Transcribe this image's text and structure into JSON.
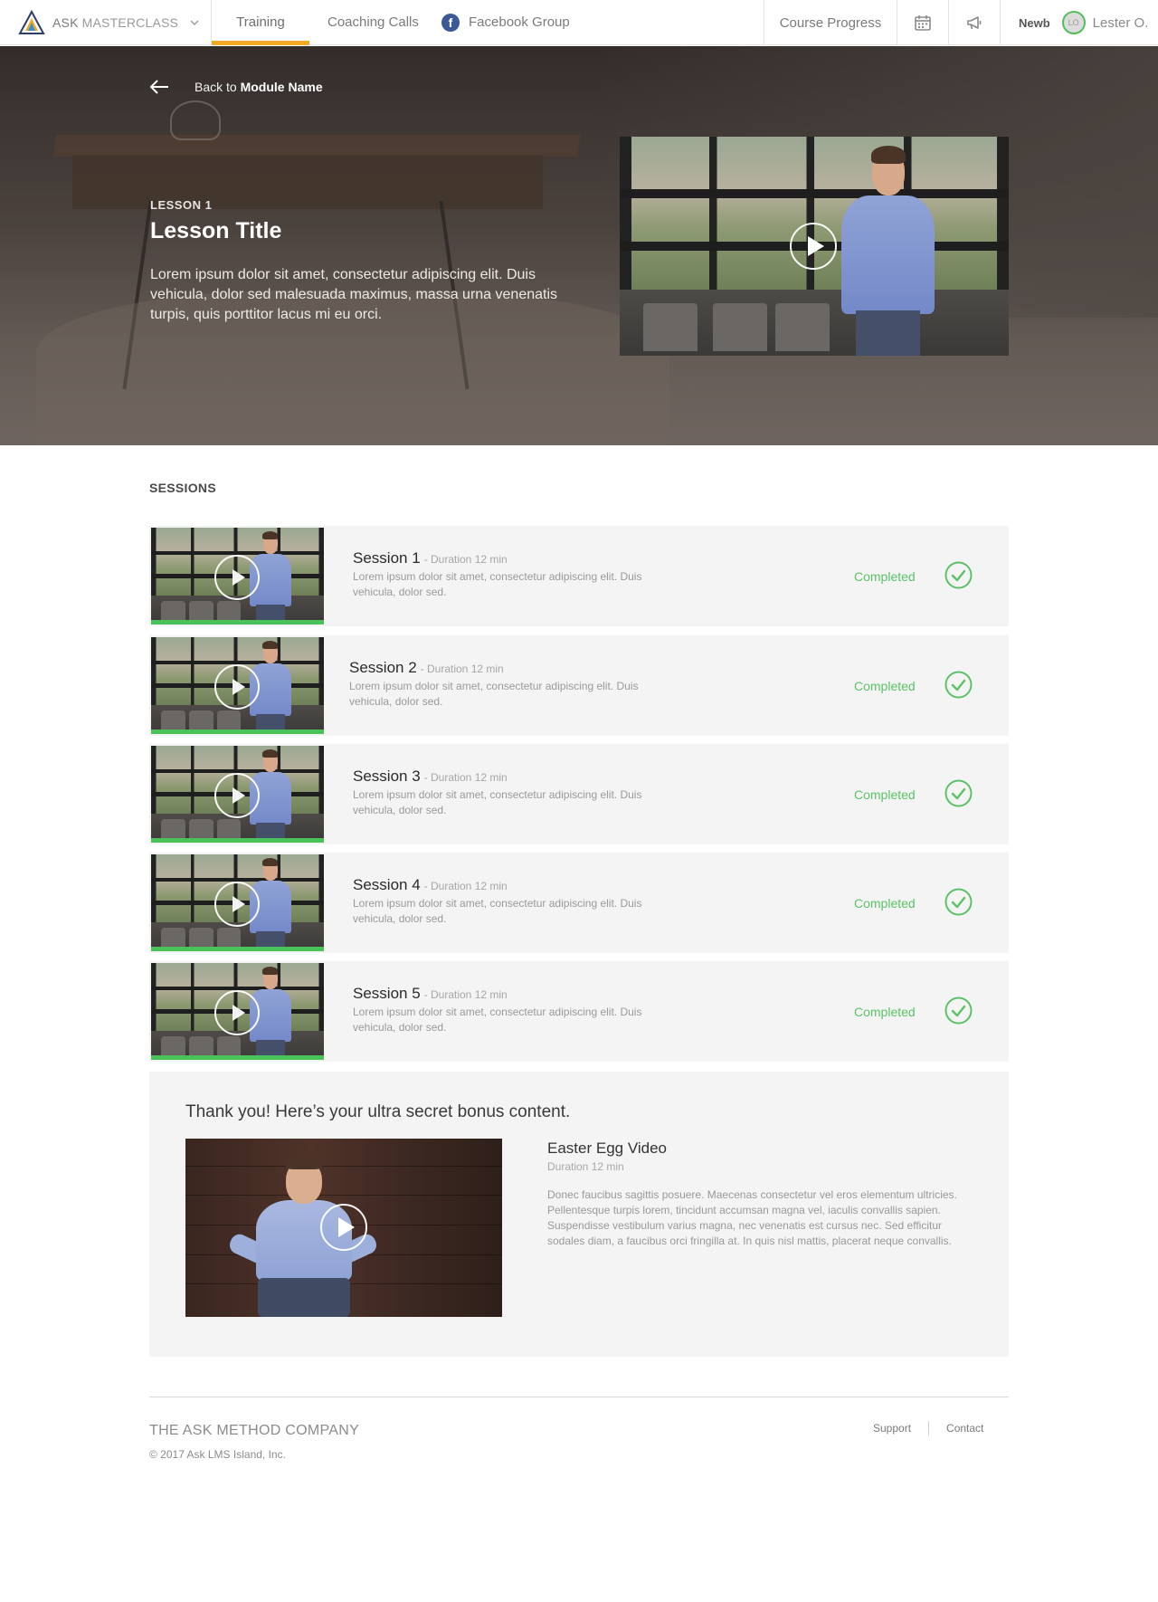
{
  "nav": {
    "brand_primary": "ASK",
    "brand_secondary": "MASTERCLASS",
    "links": {
      "training": "Training",
      "coaching": "Coaching Calls",
      "facebook": "Facebook Group"
    },
    "course_progress": "Course Progress",
    "user_level": "Newb",
    "avatar_initials": "LO",
    "user_name": "Lester O.",
    "active_tab": "Training",
    "accent_color": "#f3a928"
  },
  "hero": {
    "back_prefix": "Back to",
    "back_target": "Module Name",
    "lesson_label": "LESSON 1",
    "lesson_title": "Lesson Title",
    "lesson_description": "Lorem ipsum dolor sit amet, consectetur adipiscing elit. Duis vehicula, dolor sed malesuada maximus, massa urna venenatis turpis, quis porttitor lacus mi eu orci."
  },
  "sessions": {
    "heading": "SESSIONS",
    "status_color": "#5cc167",
    "items": [
      {
        "title": "Session 1",
        "duration": "- Duration 12 min",
        "description": "Lorem ipsum dolor sit amet, consectetur adipiscing elit. Duis vehicula, dolor sed.",
        "status": "Completed",
        "progress": 1.0
      },
      {
        "title": "Session 2",
        "duration": "- Duration 12 min",
        "description": "Lorem ipsum dolor sit amet, consectetur adipiscing elit. Duis vehicula, dolor sed.",
        "status": "Completed",
        "progress": 1.0
      },
      {
        "title": "Session 3",
        "duration": "- Duration 12 min",
        "description": "Lorem ipsum dolor sit amet, consectetur adipiscing elit. Duis vehicula, dolor sed.",
        "status": "Completed",
        "progress": 1.0
      },
      {
        "title": "Session 4",
        "duration": "- Duration 12 min",
        "description": "Lorem ipsum dolor sit amet, consectetur adipiscing elit. Duis vehicula, dolor sed.",
        "status": "Completed",
        "progress": 1.0
      },
      {
        "title": "Session 5",
        "duration": "- Duration 12 min",
        "description": "Lorem ipsum dolor sit amet, consectetur adipiscing elit. Duis vehicula, dolor sed.",
        "status": "Completed",
        "progress": 1.0
      }
    ]
  },
  "bonus": {
    "heading": "Thank you! Here’s your ultra secret bonus content.",
    "video_title": "Easter Egg Video",
    "duration": "Duration 12 min",
    "description": "Donec faucibus sagittis posuere. Maecenas consectetur vel eros elementum ultricies. Pellentesque turpis lorem, tincidunt accumsan magna vel, iaculis convallis sapien. Suspendisse vestibulum varius magna, nec venenatis est cursus nec. Sed efficitur sodales diam, a faucibus orci fringilla at. In quis nisl mattis, placerat neque convallis."
  },
  "footer": {
    "company": "THE ASK METHOD COMPANY",
    "copyright": "© 2017 Ask LMS Island, Inc.",
    "links": {
      "support": "Support",
      "contact": "Contact"
    }
  }
}
